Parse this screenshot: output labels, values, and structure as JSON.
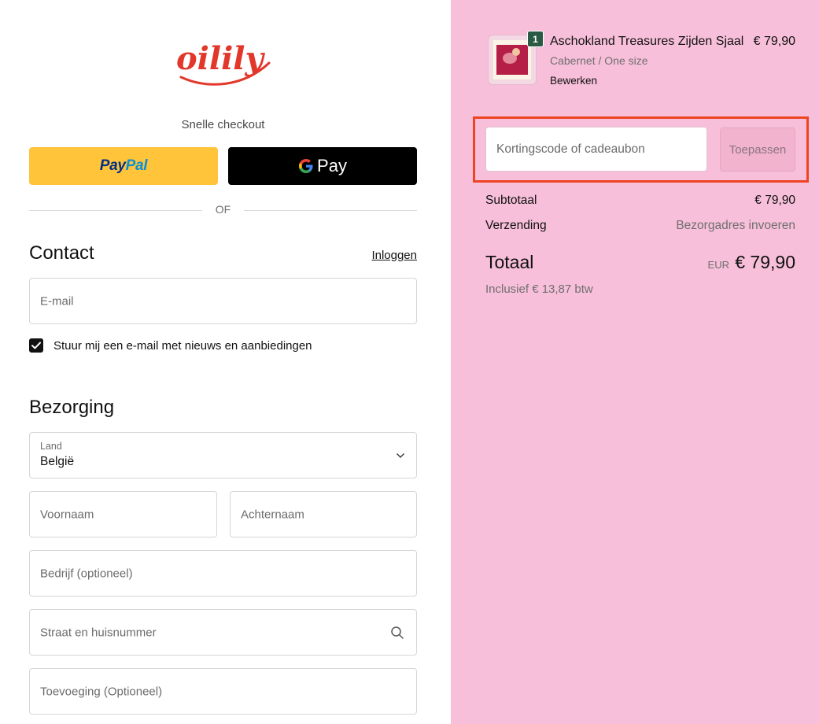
{
  "brand": {
    "logo_text": "oilily",
    "logo_color": "#e2382b"
  },
  "express": {
    "title": "Snelle checkout",
    "paypal_label_part1": "Pay",
    "paypal_label_part2": "Pal",
    "gpay_label": "Pay",
    "separator": "OF"
  },
  "contact": {
    "title": "Contact",
    "login_label": "Inloggen",
    "email_placeholder": "E-mail",
    "newsletter_label": "Stuur mij een e-mail met nieuws en aanbiedingen",
    "newsletter_checked": true
  },
  "delivery": {
    "title": "Bezorging",
    "country_label": "Land",
    "country_value": "België",
    "first_name_placeholder": "Voornaam",
    "last_name_placeholder": "Achternaam",
    "company_placeholder": "Bedrijf (optioneel)",
    "street_placeholder": "Straat en huisnummer",
    "addition_placeholder": "Toevoeging (Optioneel)"
  },
  "cart": {
    "item": {
      "title": "Aschokland Treasures Zijden Sjaal",
      "variant": "Cabernet / One size",
      "edit_label": "Bewerken",
      "price": "€ 79,90",
      "quantity": "1"
    },
    "discount": {
      "placeholder": "Kortingscode of cadeaubon",
      "apply_label": "Toepassen"
    },
    "summary": {
      "subtotal_label": "Subtotaal",
      "subtotal_value": "€ 79,90",
      "shipping_label": "Verzending",
      "shipping_value": "Bezorgadres invoeren",
      "total_label": "Totaal",
      "total_currency": "EUR",
      "total_value": "€ 79,90",
      "tax_line": "Inclusief € 13,87 btw"
    },
    "background_color": "#f7bfd9",
    "highlight_color": "#ee4422"
  }
}
